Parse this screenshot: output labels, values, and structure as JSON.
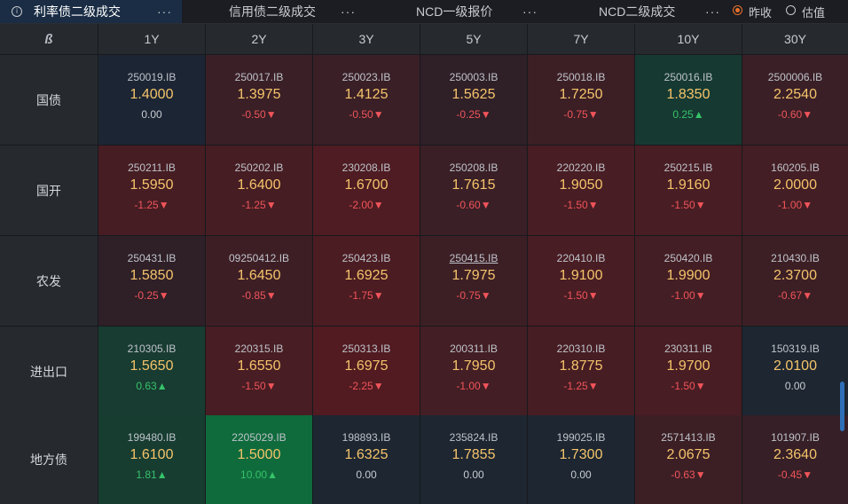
{
  "tabs": [
    {
      "label": "利率债二级成交",
      "active": true
    },
    {
      "label": "信用债二级成交",
      "active": false
    },
    {
      "label": "NCD一级报价",
      "active": false
    },
    {
      "label": "NCD二级成交",
      "active": false
    }
  ],
  "more_glyph": "···",
  "radio": [
    {
      "label": "昨收",
      "selected": true
    },
    {
      "label": "估值",
      "selected": false
    }
  ],
  "corner_logo": "ß",
  "columns": [
    "1Y",
    "2Y",
    "3Y",
    "5Y",
    "7Y",
    "10Y",
    "30Y"
  ],
  "colors": {
    "strong_red": "#4a1e24",
    "mid_red": "#3f1d22",
    "weak_red": "#33202a",
    "green": "#173a30",
    "strong_green": "#126b3a",
    "neutral": "#1e2730"
  },
  "rows": [
    {
      "label": "国债",
      "cells": [
        {
          "code": "250019.IB",
          "price": "1.4000",
          "change": "0.00",
          "dir": "zero",
          "bg": "#1c2533"
        },
        {
          "code": "250017.IB",
          "price": "1.3975",
          "change": "-0.50▼",
          "dir": "neg",
          "bg": "#3a1f26"
        },
        {
          "code": "250023.IB",
          "price": "1.4125",
          "change": "-0.50▼",
          "dir": "neg",
          "bg": "#3a1f26"
        },
        {
          "code": "250003.IB",
          "price": "1.5625",
          "change": "-0.25▼",
          "dir": "neg",
          "bg": "#2f1f27"
        },
        {
          "code": "250018.IB",
          "price": "1.7250",
          "change": "-0.75▼",
          "dir": "neg",
          "bg": "#3c1f25"
        },
        {
          "code": "250016.IB",
          "price": "1.8350",
          "change": "0.25▲",
          "dir": "pos",
          "bg": "#163a32"
        },
        {
          "code": "2500006.IB",
          "price": "2.2540",
          "change": "-0.60▼",
          "dir": "neg",
          "bg": "#3a1f26"
        }
      ]
    },
    {
      "label": "国开",
      "cells": [
        {
          "code": "250211.IB",
          "price": "1.5950",
          "change": "-1.25▼",
          "dir": "neg",
          "bg": "#461d23"
        },
        {
          "code": "250202.IB",
          "price": "1.6400",
          "change": "-1.25▼",
          "dir": "neg",
          "bg": "#461d23"
        },
        {
          "code": "230208.IB",
          "price": "1.6700",
          "change": "-2.00▼",
          "dir": "neg",
          "bg": "#4e1c22"
        },
        {
          "code": "250208.IB",
          "price": "1.7615",
          "change": "-0.60▼",
          "dir": "neg",
          "bg": "#3a1f26"
        },
        {
          "code": "220220.IB",
          "price": "1.9050",
          "change": "-1.50▼",
          "dir": "neg",
          "bg": "#481d23"
        },
        {
          "code": "250215.IB",
          "price": "1.9160",
          "change": "-1.50▼",
          "dir": "neg",
          "bg": "#481d23"
        },
        {
          "code": "160205.IB",
          "price": "2.0000",
          "change": "-1.00▼",
          "dir": "neg",
          "bg": "#431e24"
        }
      ]
    },
    {
      "label": "农发",
      "cells": [
        {
          "code": "250431.IB",
          "price": "1.5850",
          "change": "-0.25▼",
          "dir": "neg",
          "bg": "#2f1f27",
          "ul": false
        },
        {
          "code": "09250412.IB",
          "price": "1.6450",
          "change": "-0.85▼",
          "dir": "neg",
          "bg": "#3e1e25",
          "ul": false
        },
        {
          "code": "250423.IB",
          "price": "1.6925",
          "change": "-1.75▼",
          "dir": "neg",
          "bg": "#4b1c22",
          "ul": false
        },
        {
          "code": "250415.IB",
          "price": "1.7975",
          "change": "-0.75▼",
          "dir": "neg",
          "bg": "#3c1f25",
          "ul": true
        },
        {
          "code": "220410.IB",
          "price": "1.9100",
          "change": "-1.50▼",
          "dir": "neg",
          "bg": "#481d23",
          "ul": false
        },
        {
          "code": "250420.IB",
          "price": "1.9900",
          "change": "-1.00▼",
          "dir": "neg",
          "bg": "#431e24",
          "ul": false
        },
        {
          "code": "210430.IB",
          "price": "2.3700",
          "change": "-0.67▼",
          "dir": "neg",
          "bg": "#3c1f25",
          "ul": false
        }
      ]
    },
    {
      "label": "进出口",
      "cells": [
        {
          "code": "210305.IB",
          "price": "1.5650",
          "change": "0.63▲",
          "dir": "pos",
          "bg": "#183c31"
        },
        {
          "code": "220315.IB",
          "price": "1.6550",
          "change": "-1.50▼",
          "dir": "neg",
          "bg": "#481d23"
        },
        {
          "code": "250313.IB",
          "price": "1.6975",
          "change": "-2.25▼",
          "dir": "neg",
          "bg": "#511b21"
        },
        {
          "code": "200311.IB",
          "price": "1.7950",
          "change": "-1.00▼",
          "dir": "neg",
          "bg": "#431e24"
        },
        {
          "code": "220310.IB",
          "price": "1.8775",
          "change": "-1.25▼",
          "dir": "neg",
          "bg": "#461d23"
        },
        {
          "code": "230311.IB",
          "price": "1.9700",
          "change": "-1.50▼",
          "dir": "neg",
          "bg": "#481d23"
        },
        {
          "code": "150319.IB",
          "price": "2.0100",
          "change": "0.00",
          "dir": "zero",
          "bg": "#1d2631"
        }
      ]
    },
    {
      "label": "地方债",
      "cells": [
        {
          "code": "199480.IB",
          "price": "1.6100",
          "change": "1.81▲",
          "dir": "pos",
          "bg": "#173d31"
        },
        {
          "code": "2205029.IB",
          "price": "1.5000",
          "change": "10.00▲",
          "dir": "pos",
          "bg": "#0f6b3c"
        },
        {
          "code": "198893.IB",
          "price": "1.6325",
          "change": "0.00",
          "dir": "zero",
          "bg": "#1d2631"
        },
        {
          "code": "235824.IB",
          "price": "1.7855",
          "change": "0.00",
          "dir": "zero",
          "bg": "#1d2631"
        },
        {
          "code": "199025.IB",
          "price": "1.7300",
          "change": "0.00",
          "dir": "zero",
          "bg": "#1d2631"
        },
        {
          "code": "2571413.IB",
          "price": "2.0675",
          "change": "-0.63▼",
          "dir": "neg",
          "bg": "#3c1f25"
        },
        {
          "code": "101907.IB",
          "price": "2.3640",
          "change": "-0.45▼",
          "dir": "neg",
          "bg": "#361f26"
        }
      ]
    }
  ]
}
